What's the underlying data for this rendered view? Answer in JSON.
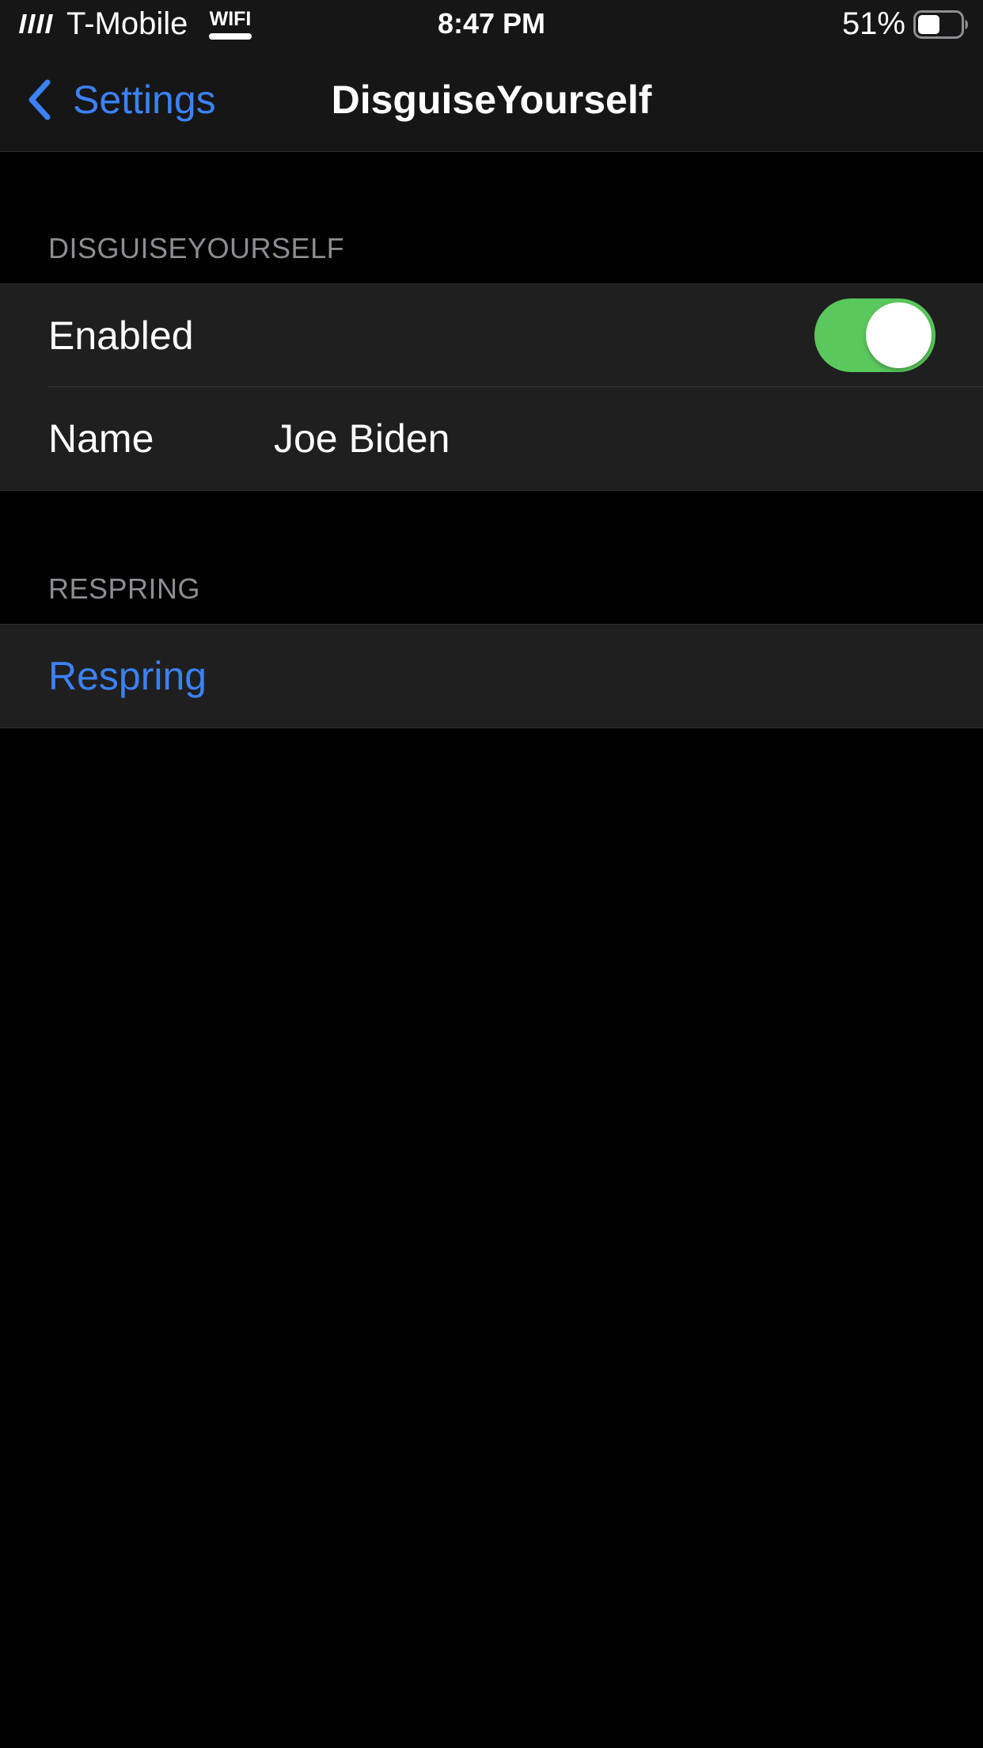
{
  "status_bar": {
    "carrier": "T-Mobile",
    "wifi_label": "WIFI",
    "time": "8:47 PM",
    "battery_percent": "51%",
    "battery_level": 0.51,
    "icons": [
      "signal-bars-icon",
      "wifi-badge-icon",
      "battery-icon"
    ]
  },
  "nav": {
    "back_label": "Settings",
    "title": "DisguiseYourself",
    "back_icon": "chevron-left-icon"
  },
  "sections": [
    {
      "header": "DISGUISEYOURSELF",
      "rows": [
        {
          "label": "Enabled",
          "type": "toggle",
          "value": true
        },
        {
          "label": "Name",
          "type": "text",
          "value": "Joe Biden"
        }
      ]
    },
    {
      "header": "RESPRING",
      "rows": [
        {
          "label": "Respring",
          "type": "action"
        }
      ]
    }
  ],
  "colors": {
    "accent": "#3b82f6",
    "toggle_on": "#5ac85c",
    "background": "#000000",
    "cell_background": "#1f1f1f",
    "bar_background": "#161616",
    "section_header": "#8d8d93"
  }
}
